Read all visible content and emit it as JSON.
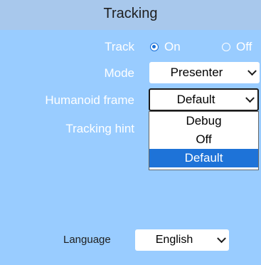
{
  "header": {
    "title": "Tracking"
  },
  "track": {
    "label": "Track",
    "options": [
      "On",
      "Off"
    ],
    "selected": "On"
  },
  "mode": {
    "label": "Mode",
    "value": "Presenter"
  },
  "humanoid_frame": {
    "label": "Humanoid frame",
    "value": "Default",
    "options": [
      "Debug",
      "Off",
      "Default"
    ],
    "highlighted": "Default"
  },
  "tracking_hint": {
    "label": "Tracking hint"
  },
  "language": {
    "label": "Language",
    "value": "English"
  },
  "colors": {
    "background": "#99ccff",
    "header": "#a8c8ec",
    "selection": "#1e73d8"
  },
  "icons": [
    "radio-on-icon",
    "radio-off-icon",
    "chevron-down-icon"
  ]
}
